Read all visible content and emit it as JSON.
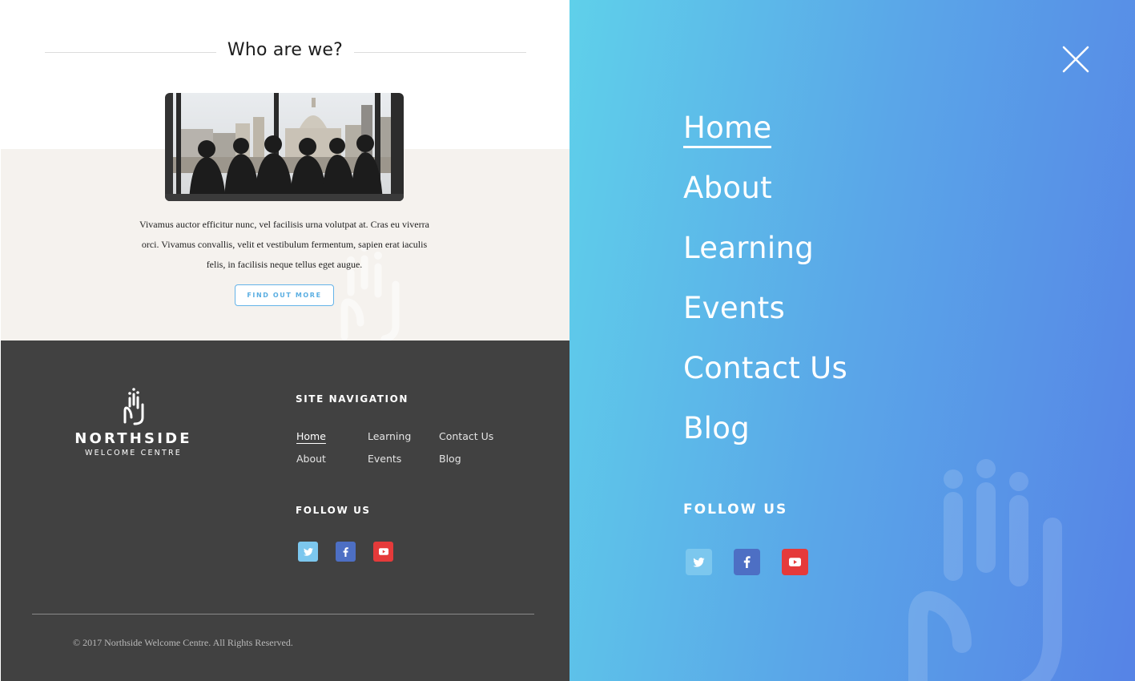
{
  "about": {
    "title": "Who are we?",
    "text_line1": "Vivamus auctor efficitur nunc, vel facilisis urna volutpat at. Cras eu viverra",
    "text_line2": "orci. Vivamus convallis, velit et vestibulum fermentum, sapien erat iaculis",
    "text_line3": "felis, in facilisis neque tellus eget augue.",
    "button_label": "FIND OUT MORE"
  },
  "footer": {
    "logo_name": "NORTHSIDE",
    "logo_sub": "WELCOME CENTRE",
    "nav_heading": "SITE NAVIGATION",
    "nav_links": {
      "home": "Home",
      "learning": "Learning",
      "contact": "Contact Us",
      "about": "About",
      "events": "Events",
      "blog": "Blog"
    },
    "active_link": "Home",
    "follow_heading": "FOLLOW US",
    "copyright": "© 2017 Northside Welcome Centre. All Rights Reserved."
  },
  "menu": {
    "items": [
      "Home",
      "About",
      "Learning",
      "Events",
      "Contact Us",
      "Blog"
    ],
    "active_item": "Home",
    "follow_heading": "FOLLOW US",
    "close_icon": "close-icon"
  },
  "social": [
    {
      "name": "twitter",
      "icon": "twitter-icon",
      "color": "#7cc7ee"
    },
    {
      "name": "facebook",
      "icon": "facebook-icon",
      "color": "#4d6fc4"
    },
    {
      "name": "youtube",
      "icon": "youtube-icon",
      "color": "#e53a3a"
    }
  ],
  "colors": {
    "menu_gradient_start": "#5fd0ea",
    "menu_gradient_end": "#5683e6",
    "footer_bg": "#414141",
    "band_bg": "#f5f2ee",
    "button_accent": "#5aaee2"
  }
}
